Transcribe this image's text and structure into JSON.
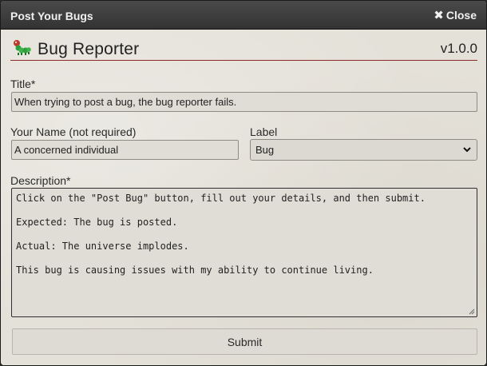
{
  "window": {
    "title": "Post Your Bugs",
    "close_label": "Close"
  },
  "header": {
    "app_title": "Bug Reporter",
    "version": "v1.0.0",
    "icon": "caterpillar-icon"
  },
  "form": {
    "title_label": "Title*",
    "title_value": "When trying to post a bug, the bug reporter fails.",
    "name_label": "Your Name (not required)",
    "name_value": "A concerned individual",
    "label_label": "Label",
    "label_selected": "Bug",
    "description_label": "Description*",
    "description_lines": [
      "Click on the \"Post Bug\" button, fill out your details, and then submit.",
      "Expected: The bug is posted.",
      "Actual: The universe implodes.",
      "This bug is causing issues with my ability to continue living."
    ],
    "submit_label": "Submit"
  },
  "colors": {
    "titlebar": "#3a3a3a",
    "header_rule": "#8b2a2a",
    "background": "#e4e1d9"
  }
}
